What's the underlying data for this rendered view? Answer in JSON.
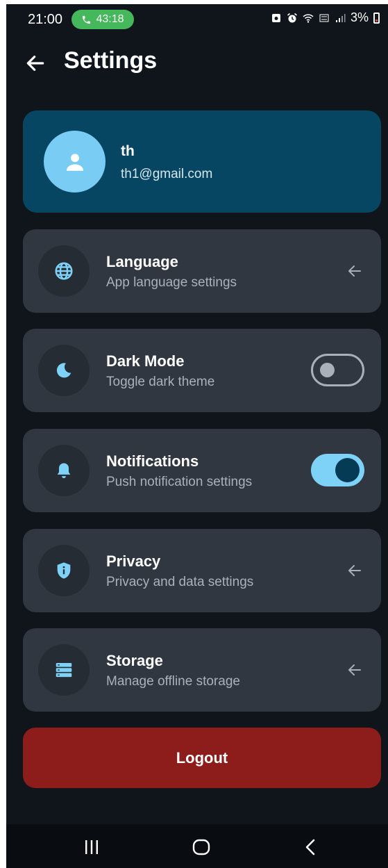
{
  "status_bar": {
    "time": "21:00",
    "call_timer": "43:18",
    "battery": "3%",
    "icons": [
      "phone-icon",
      "screenshot-icon",
      "alarm-icon",
      "wifi-icon",
      "volte-icon",
      "signal-icon",
      "battery-icon"
    ],
    "call_color": "#44b85a"
  },
  "header": {
    "title": "Settings",
    "back_icon": "arrow-left-icon"
  },
  "profile": {
    "name": "th",
    "email": "th1@gmail.com",
    "avatar_icon": "person-icon",
    "card_color": "#074663"
  },
  "settings": [
    {
      "title": "Language",
      "subtitle": "App language settings",
      "icon": "globe-icon",
      "control": "chevron"
    },
    {
      "title": "Dark Mode",
      "subtitle": "Toggle dark theme",
      "icon": "moon-icon",
      "control": "toggle",
      "toggle_on": false
    },
    {
      "title": "Notifications",
      "subtitle": "Push notification settings",
      "icon": "bell-icon",
      "control": "toggle",
      "toggle_on": true
    },
    {
      "title": "Privacy",
      "subtitle": "Privacy and data settings",
      "icon": "shield-info-icon",
      "control": "chevron"
    },
    {
      "title": "Storage",
      "subtitle": "Manage offline storage",
      "icon": "storage-icon",
      "control": "chevron"
    }
  ],
  "logout": {
    "label": "Logout",
    "color": "#8c1d1a"
  },
  "accent_color": "#7ed2f8",
  "nav_bar": {
    "buttons": [
      "recents-icon",
      "home-icon",
      "back-icon"
    ]
  }
}
